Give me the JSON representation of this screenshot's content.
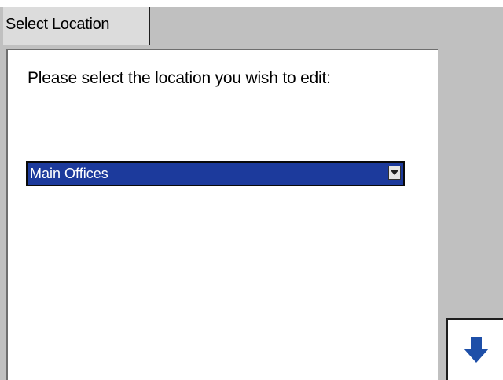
{
  "window": {
    "tab_label": "Select Location"
  },
  "form": {
    "prompt": "Please select the location you wish to edit:",
    "location_select": {
      "selected_value": "Main Offices"
    }
  },
  "navigation": {
    "next_button_icon": "arrow-down-icon"
  },
  "colors": {
    "selection_highlight": "#1c3a9c",
    "arrow_icon": "#1e4fa8",
    "frame_background": "#c0c0c0"
  }
}
